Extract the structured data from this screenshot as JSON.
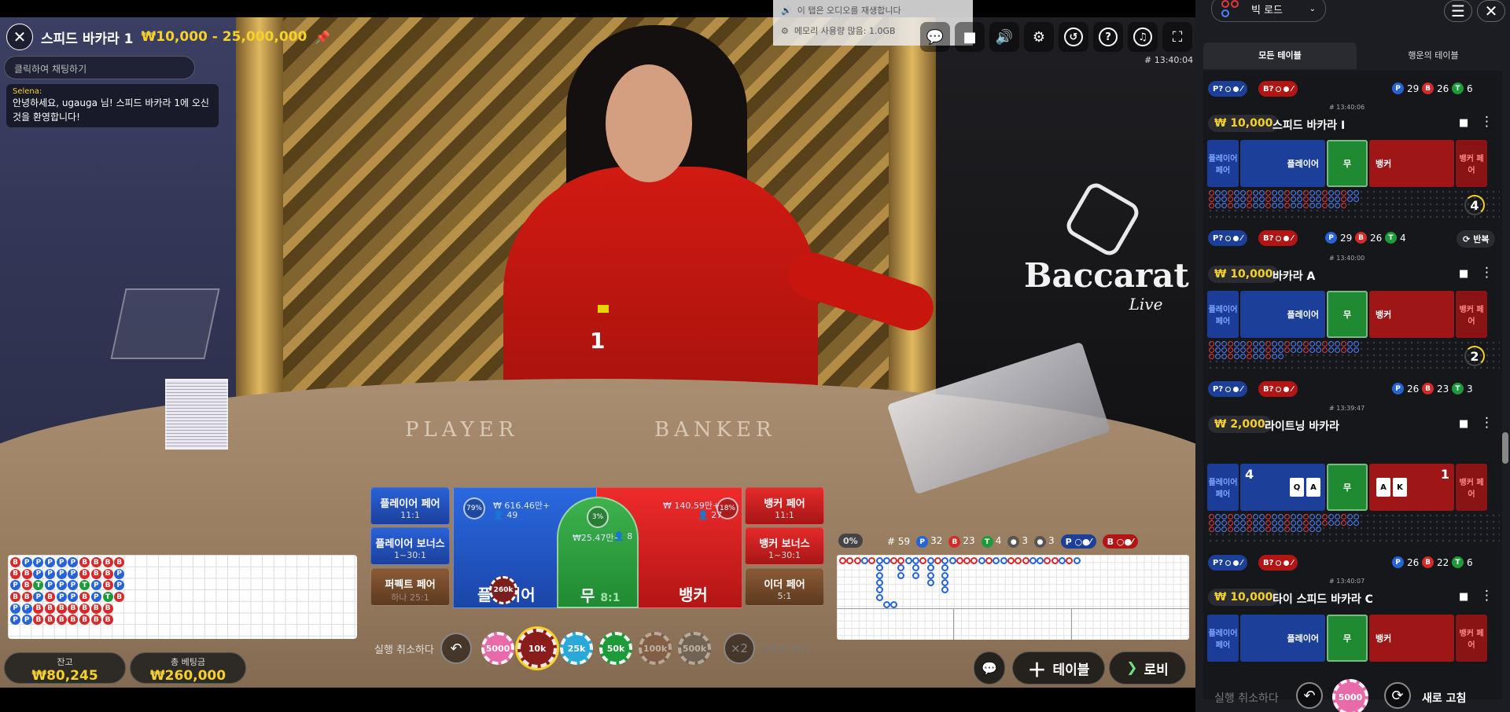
{
  "toast": {
    "line1": "이 탭은 오디오를 재생합니다",
    "line2": "메모리 사용량 많음: 1.0GB"
  },
  "header": {
    "title": "스피드 바카라 1",
    "limits": "₩10,000 - 25,000,000",
    "timestamp": "# 13:40:04"
  },
  "chat": {
    "placeholder": "클릭하여 채팅하기",
    "sender": "Selena:",
    "message": "안녕하세요, ugauga 님! 스피드 바카라 1에 오신 것을 환영합니다!"
  },
  "video": {
    "round_label": "1",
    "felt_player": "PLAYER",
    "felt_banker": "BANKER",
    "logo_main": "Baccarat",
    "logo_sub": "Live"
  },
  "bead_plate": [
    "B",
    "B",
    "P",
    "B",
    "P",
    "P",
    "P",
    "B",
    "B",
    "B",
    "P",
    "P",
    "P",
    "P",
    "T",
    "P",
    "B",
    "B",
    "P",
    "P",
    "P",
    "B",
    "B",
    "B",
    "P",
    "P",
    "P",
    "P",
    "B",
    "B",
    "P",
    "P",
    "P",
    "P",
    "B",
    "B",
    "B",
    "B",
    "T",
    "B",
    "B",
    "B",
    "B",
    "B",
    "P",
    "P",
    "B",
    "B",
    "B",
    "B",
    "B",
    "T",
    "B",
    "B",
    "B",
    "P",
    "P",
    "B",
    "",
    ""
  ],
  "balance": {
    "label": "잔고",
    "value": "₩80,245"
  },
  "total_bet": {
    "label": "총 베팅금",
    "value": "₩260,000"
  },
  "bets": {
    "player_pair": {
      "name": "플레이어 페어",
      "odds": "11:1"
    },
    "player_bonus": {
      "name": "플레이어 보너스",
      "odds": "1~30:1"
    },
    "perfect_pair": {
      "name": "퍼펙트 페어",
      "odds": "하나 25:1"
    },
    "banker_pair": {
      "name": "뱅커 페어",
      "odds": "11:1"
    },
    "banker_bonus": {
      "name": "뱅커 보너스",
      "odds": "1~30:1"
    },
    "either_pair": {
      "name": "이더 페어",
      "odds": "5:1"
    },
    "player": {
      "name": "플레이어",
      "pct": "79%",
      "amount": "₩ 616.46만+",
      "players": "49"
    },
    "tie": {
      "name": "무",
      "odds": "8:1",
      "pct": "3%",
      "amount": "₩25.47만+",
      "players": "8"
    },
    "banker": {
      "name": "뱅커",
      "pct": "18%",
      "amount": "₩ 140.59만+",
      "players": "27"
    },
    "placed_chip": "260k"
  },
  "chips": {
    "cancel_label": "실행 취소하다",
    "values": [
      "5000",
      "10k",
      "25k",
      "50k",
      "100k",
      "500k"
    ],
    "colors": [
      "#e86aa8",
      "#8a1c1c",
      "#2aa9d8",
      "#1d9b3a",
      "#7a4a33",
      "#555555"
    ],
    "double": "×2",
    "double_label": "2배로 하다"
  },
  "road_stats": {
    "progress": "0%",
    "rounds": "# 59",
    "p": "32",
    "b": "23",
    "t": "4",
    "pp": "3",
    "bp": "3",
    "p_tag": "P",
    "b_tag": "B"
  },
  "buttons": {
    "table": "테이블",
    "lobby": "로비"
  },
  "side": {
    "road_select": "빅 로드",
    "tabs": [
      "모든 테이블",
      "행운의 테이블"
    ],
    "top_stats": {
      "p": "29",
      "b": "26",
      "t": "6"
    },
    "tables": [
      {
        "bet": "₩ 10,000",
        "name": "스피드 바카라 I",
        "time": "# 13:40:06",
        "timer": "4",
        "repeat": "반복",
        "p": "29",
        "b": "26",
        "t": "4"
      },
      {
        "bet": "₩ 10,000",
        "name": "바카라 A",
        "time": "# 13:40:00",
        "timer": "2",
        "p": "26",
        "b": "23",
        "t": "3"
      },
      {
        "bet": "₩ 2,000",
        "name": "라이트닝 바카라",
        "time": "# 13:39:47",
        "player_score": "4",
        "banker_score": "1",
        "p": "26",
        "b": "22",
        "t": "6",
        "p_cards": [
          "Q",
          "A"
        ],
        "b_cards": [
          "A",
          "K"
        ]
      },
      {
        "bet": "₩ 10,000",
        "name": "타이 스피드 바카라 C",
        "time": "# 13:40:07"
      }
    ],
    "mini_labels": {
      "pp": "플레이어 페어",
      "player": "플레이어",
      "tie": "무",
      "banker": "뱅커",
      "bp": "뱅커 페어"
    },
    "bottom": {
      "cancel": "실행 취소하다",
      "chip": "5000",
      "refresh": "새로 고침"
    },
    "tag_p": "P?",
    "tag_b": "B?"
  }
}
